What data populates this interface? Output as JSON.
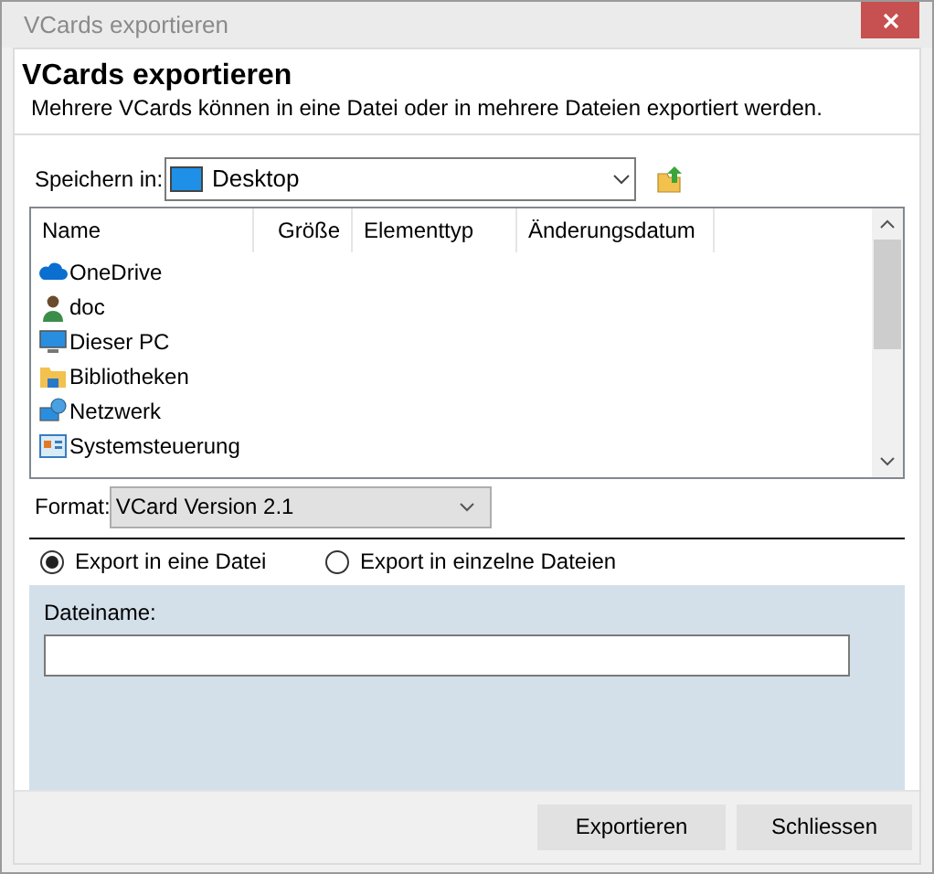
{
  "window": {
    "title": "VCards exportieren"
  },
  "header": {
    "title": "VCards exportieren",
    "subtitle": "Mehrere VCards können in eine Datei oder in mehrere Dateien exportiert werden."
  },
  "save_in": {
    "label": "Speichern in:",
    "value": "Desktop"
  },
  "file_list": {
    "columns": [
      "Name",
      "Größe",
      "Elementtyp",
      "Änderungsdatum"
    ],
    "rows": [
      {
        "name": "OneDrive",
        "kind": "cloud"
      },
      {
        "name": "doc",
        "kind": "user"
      },
      {
        "name": "Dieser PC",
        "kind": "pc"
      },
      {
        "name": "Bibliotheken",
        "kind": "library"
      },
      {
        "name": "Netzwerk",
        "kind": "network"
      },
      {
        "name": "Systemsteuerung",
        "kind": "control"
      }
    ]
  },
  "format": {
    "label": "Format:",
    "value": "VCard Version 2.1"
  },
  "export_mode": [
    {
      "label": "Export in eine Datei",
      "selected": true
    },
    {
      "label": "Export in einzelne Dateien",
      "selected": false
    }
  ],
  "filename": {
    "label": "Dateiname:"
  },
  "buttons": [
    "Exportieren",
    "Schliessen"
  ]
}
